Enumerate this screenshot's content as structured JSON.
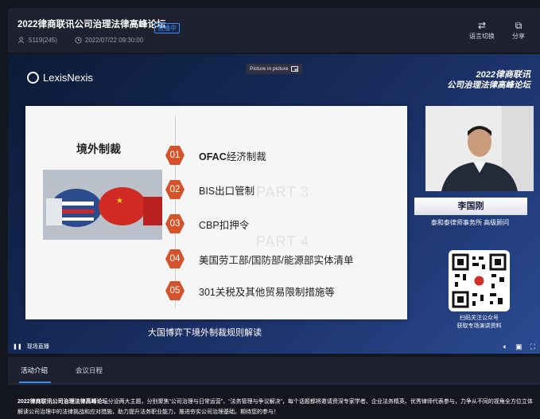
{
  "header": {
    "title": "2022律商联讯公司治理法律高峰论坛",
    "live_badge": "直播中",
    "viewers": "5119(245)",
    "datetime": "2022/07/22 09:30:00",
    "language_btn": "语言切换",
    "share_btn": "分享"
  },
  "video": {
    "brand": "LexisNexis",
    "pip_label": "Picture in picture",
    "forum_logo_line1": "2022律商联讯",
    "forum_logo_line2": "公司治理法律高峰论坛",
    "slide": {
      "heading": "境外制裁",
      "watermark_1": "PART 3",
      "watermark_2": "PART 4",
      "items": [
        {
          "num": "01",
          "bold": "OFAC",
          "text": "经济制裁"
        },
        {
          "num": "02",
          "text": "BIS出口管制"
        },
        {
          "num": "03",
          "text": "CBP扣押令"
        },
        {
          "num": "04",
          "text": "美国劳工部/国防部/能源部实体清单"
        },
        {
          "num": "05",
          "text": "301关税及其他贸易限制措施等"
        }
      ]
    },
    "subtitle": "大国博弈下境外制裁规则解读",
    "speaker_name": "李国刚",
    "speaker_title": "泰和泰律师事务所 高级顾问",
    "qr_caption_line1": "扫码关注公众号",
    "qr_caption_line2": "获取专场演讲资料",
    "live_status": "现场直播"
  },
  "tabs": [
    {
      "label": "活动介绍",
      "active": true
    },
    {
      "label": "会议日程",
      "active": false
    }
  ],
  "description": {
    "bold_part": "2022律商联讯公司治理法律高峰论坛",
    "text": "分设两大主题，分别聚焦“公司治理与日常运营”、“法务管理与争议解决”，每个话题都将邀请资深专家学者、企业法务精英、优秀律师代表参与，力争从不同的视角全方位立体解读公司治理中的法律挑战和应对措施，助力提升法务职业能力，推进夯实公司治理基础。期待您的参与！"
  },
  "colors": {
    "accent": "#3d8cff",
    "slide_num": "#d5532b",
    "background": "#14161f",
    "panel": "#1e2130"
  }
}
